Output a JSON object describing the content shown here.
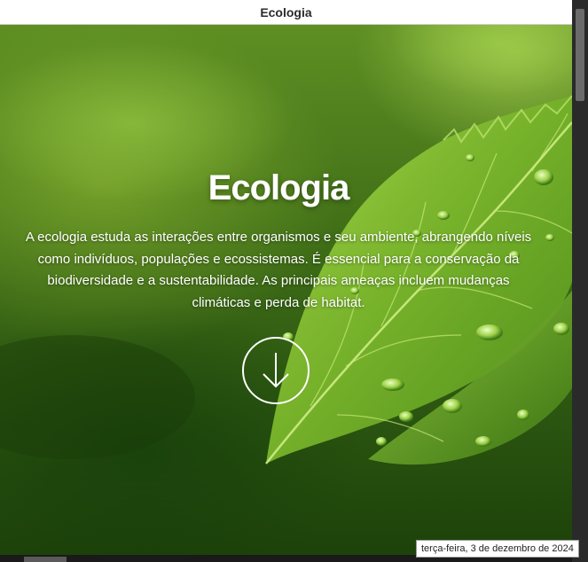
{
  "window": {
    "title": "Ecologia"
  },
  "hero": {
    "title": "Ecologia",
    "paragraph": "A ecologia estuda as interações entre organismos e seu ambiente, abrangendo níveis como indivíduos, populações e ecossistemas. É essencial para a conservação da biodiversidade e a sustentabilidade. As principais ameaças incluem mudanças climáticas e perda de habitat.",
    "background_image": "green-leaf-with-water-drops",
    "scroll_icon": "arrow-down-icon"
  },
  "taskbar": {
    "date": "terça-feira, 3 de dezembro de 2024"
  },
  "colors": {
    "foliage_dark": "#2a5410",
    "foliage_light": "#8bc43a",
    "text": "#ffffff"
  }
}
